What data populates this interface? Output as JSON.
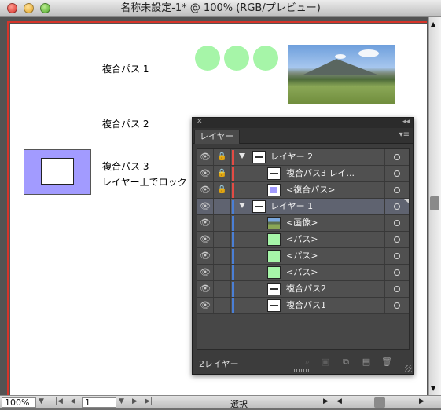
{
  "window": {
    "title": "名称未設定-1* @ 100% (RGB/プレビュー)"
  },
  "artboard": {
    "labels": [
      "複合パス 1",
      "複合パス 2",
      "複合パス 3",
      "レイヤー上でロック"
    ]
  },
  "colors": {
    "circle": "#a6f5a8",
    "purple": "#a29bff",
    "red_layer": "#e34b44",
    "blue_layer": "#4a7fd6"
  },
  "layers_panel": {
    "tab": "レイヤー",
    "rows": [
      {
        "label": "レイヤー 2",
        "lock": "lock-icon",
        "color": "red",
        "type": "layer",
        "selected": false
      },
      {
        "label": "複合パス3 レイ...",
        "lock": "lock-icon-dim",
        "color": "red",
        "type": "path",
        "selected": false
      },
      {
        "label": "<複合パス>",
        "lock": "lock-icon-dim",
        "color": "red",
        "type": "path",
        "selected": false
      },
      {
        "label": "レイヤー 1",
        "lock": "",
        "color": "blue",
        "type": "layer",
        "selected": true
      },
      {
        "label": "<画像>",
        "lock": "",
        "color": "blue",
        "type": "image",
        "selected": false
      },
      {
        "label": "<パス>",
        "lock": "",
        "color": "blue",
        "type": "path-green",
        "selected": false
      },
      {
        "label": "<パス>",
        "lock": "",
        "color": "blue",
        "type": "path-green",
        "selected": false
      },
      {
        "label": "<パス>",
        "lock": "",
        "color": "blue",
        "type": "path-green",
        "selected": false
      },
      {
        "label": "複合パス2",
        "lock": "",
        "color": "blue",
        "type": "path",
        "selected": false
      },
      {
        "label": "複合パス1",
        "lock": "",
        "color": "blue",
        "type": "path",
        "selected": false
      }
    ],
    "footer_count": "2レイヤー"
  },
  "statusbar": {
    "zoom": "100%",
    "page": "1",
    "tool": "選択"
  }
}
